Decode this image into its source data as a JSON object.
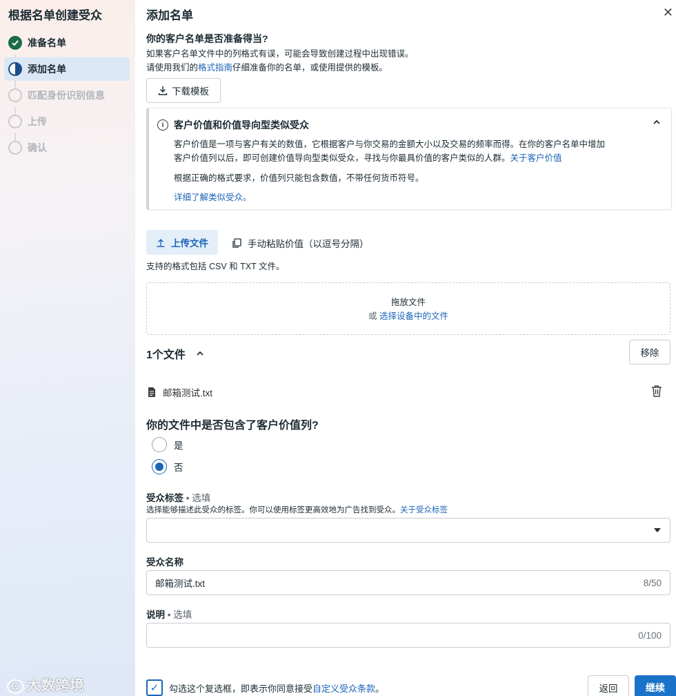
{
  "sidebar": {
    "title": "根据名单创建受众",
    "steps": [
      {
        "label": "准备名单",
        "state": "done"
      },
      {
        "label": "添加名单",
        "state": "active"
      },
      {
        "label": "匹配身份识别信息",
        "state": "pending"
      },
      {
        "label": "上传",
        "state": "pending"
      },
      {
        "label": "确认",
        "state": "pending"
      }
    ]
  },
  "main": {
    "title": "添加名单",
    "question": "你的客户名单是否准备得当?",
    "hint1": "如果客户名单文件中的列格式有误，可能会导致创建过程中出现错误。",
    "hint2_pre": "请使用我们的",
    "hint2_link": "格式指南",
    "hint2_post": "仔细准备你的名单，或使用提供的模板。",
    "download_button": "下载模板"
  },
  "info": {
    "title": "客户价值和价值导向型类似受众",
    "body1": "客户价值是一项与客户有关的数值，它根据客户与你交易的金额大小以及交易的频率而得。在你的客户名单中增加",
    "body2": "客户价值列以后，即可创建价值导向型类似受众，寻找与你最具价值的客户类似的人群。",
    "body2_link": "关于客户价值",
    "body3": "根据正确的格式要求，价值列只能包含数值，不带任何货币符号。",
    "link": "详细了解类似受众。"
  },
  "upload": {
    "tab_upload": "上传文件",
    "tab_paste": "手动粘贴价值（以逗号分隔）",
    "formats": "支持的格式包括 CSV 和 TXT 文件。",
    "drop_text": "拖放文件",
    "or": "或",
    "choose_link": "选择设备中的文件",
    "file_count": "1个文件",
    "remove_button": "移除",
    "file_name": "邮箱测试.txt"
  },
  "value_question": {
    "title": "你的文件中是否包含了客户价值列?",
    "options": [
      {
        "label": "是",
        "selected": false
      },
      {
        "label": "否",
        "selected": true
      }
    ]
  },
  "tags": {
    "label": "受众标签",
    "optional": " • 选填",
    "hint": "选择能够描述此受众的标签。你可以使用标签更高效地为广告找到受众。",
    "hint_link": "关于受众标签",
    "value": ""
  },
  "name": {
    "label": "受众名称",
    "value": "邮箱测试.txt",
    "counter": "8/50"
  },
  "description": {
    "label": "说明",
    "optional": " • 选填",
    "value": "",
    "counter": "0/100"
  },
  "footer": {
    "checkbox_text": "勾选这个复选框，即表示你同意接受",
    "checkbox_link": "自定义受众条款",
    "checkbox_end": "。",
    "back_button": "返回",
    "continue_button": "继续"
  },
  "watermark": "大数跨境",
  "colors": {
    "accent": "#1a64b8",
    "primary_button": "#1a73c8",
    "done_step": "#1d6b4a"
  }
}
